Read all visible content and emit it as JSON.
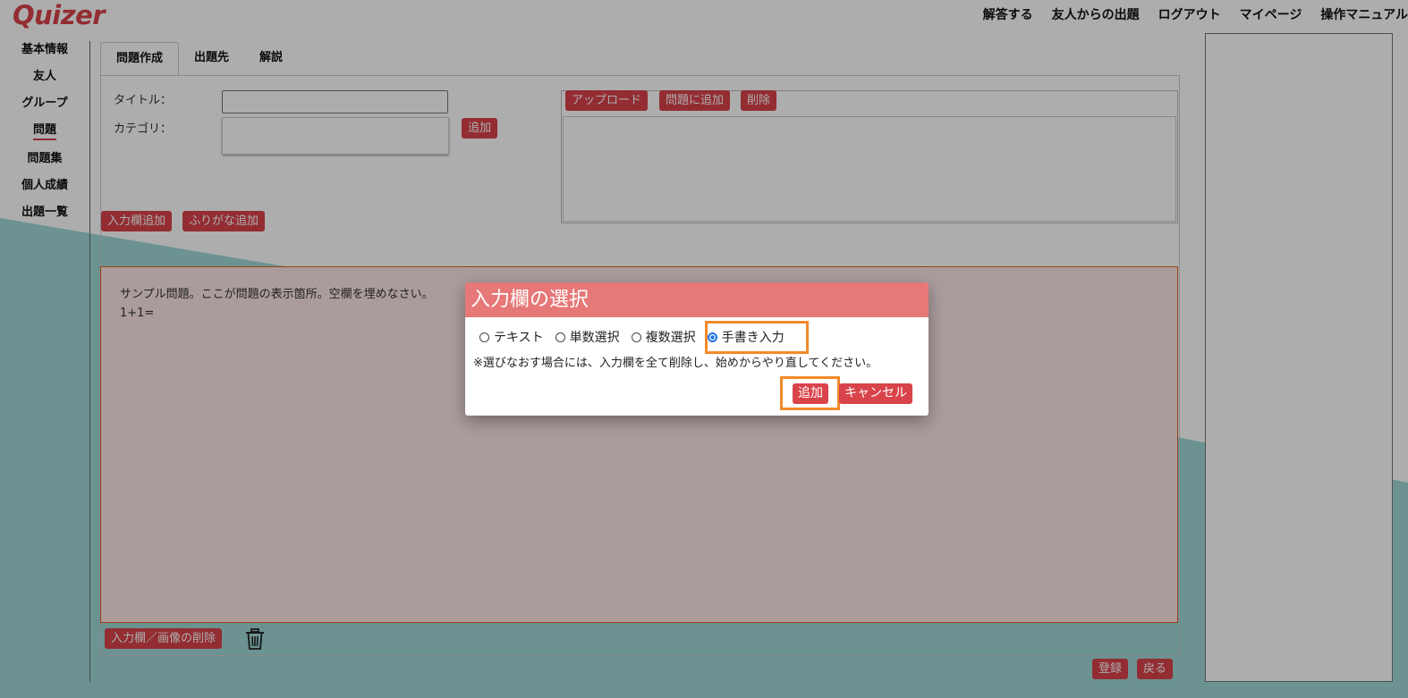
{
  "header": {
    "logo": "Quizer",
    "nav": [
      "解答する",
      "友人からの出題",
      "ログアウト",
      "マイページ",
      "操作マニュアル"
    ]
  },
  "sidebar": {
    "items": [
      "基本情報",
      "友人",
      "グループ",
      "問題",
      "問題集",
      "個人成績",
      "出題一覧"
    ],
    "active": "問題"
  },
  "tabs": [
    "問題作成",
    "出題先",
    "解説"
  ],
  "form": {
    "title_label": "タイトル：",
    "title_value": "",
    "category_label": "カテゴリ：",
    "category_add": "追加",
    "add_input": "入力欄追加",
    "add_furigana": "ふりがな追加"
  },
  "upload": {
    "upload_btn": "アップロード",
    "add_to_question": "問題に追加",
    "delete": "削除"
  },
  "question": {
    "line1": "サンプル問題。ここが問題の表示箇所。空欄を埋めなさい。",
    "line2": "1+1="
  },
  "footer": {
    "delete_input_image": "入力欄／画像の削除",
    "trash_icon": "trash-icon",
    "register": "登録",
    "back": "戻る"
  },
  "modal": {
    "title": "入力欄の選択",
    "options": [
      "テキスト",
      "単数選択",
      "複数選択",
      "手書き入力"
    ],
    "selected": "手書き入力",
    "note": "※選びなおす場合には、入力欄を全て削除し、始めからやり直してください。",
    "add": "追加",
    "cancel": "キャンセル"
  },
  "colors": {
    "accent": "#d9434a",
    "modal_header": "#e67878",
    "highlight": "#f28a2a",
    "teal_bg": "#a0d8d8",
    "question_border": "#e0601d"
  }
}
